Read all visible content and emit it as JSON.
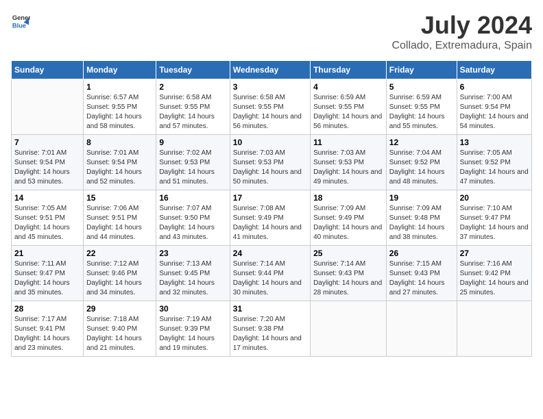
{
  "header": {
    "logo_general": "General",
    "logo_blue": "Blue",
    "month_year": "July 2024",
    "location": "Collado, Extremadura, Spain"
  },
  "weekdays": [
    "Sunday",
    "Monday",
    "Tuesday",
    "Wednesday",
    "Thursday",
    "Friday",
    "Saturday"
  ],
  "weeks": [
    [
      {
        "day": "",
        "sunrise": "",
        "sunset": "",
        "daylight": ""
      },
      {
        "day": "1",
        "sunrise": "Sunrise: 6:57 AM",
        "sunset": "Sunset: 9:55 PM",
        "daylight": "Daylight: 14 hours and 58 minutes."
      },
      {
        "day": "2",
        "sunrise": "Sunrise: 6:58 AM",
        "sunset": "Sunset: 9:55 PM",
        "daylight": "Daylight: 14 hours and 57 minutes."
      },
      {
        "day": "3",
        "sunrise": "Sunrise: 6:58 AM",
        "sunset": "Sunset: 9:55 PM",
        "daylight": "Daylight: 14 hours and 56 minutes."
      },
      {
        "day": "4",
        "sunrise": "Sunrise: 6:59 AM",
        "sunset": "Sunset: 9:55 PM",
        "daylight": "Daylight: 14 hours and 56 minutes."
      },
      {
        "day": "5",
        "sunrise": "Sunrise: 6:59 AM",
        "sunset": "Sunset: 9:55 PM",
        "daylight": "Daylight: 14 hours and 55 minutes."
      },
      {
        "day": "6",
        "sunrise": "Sunrise: 7:00 AM",
        "sunset": "Sunset: 9:54 PM",
        "daylight": "Daylight: 14 hours and 54 minutes."
      }
    ],
    [
      {
        "day": "7",
        "sunrise": "Sunrise: 7:01 AM",
        "sunset": "Sunset: 9:54 PM",
        "daylight": "Daylight: 14 hours and 53 minutes."
      },
      {
        "day": "8",
        "sunrise": "Sunrise: 7:01 AM",
        "sunset": "Sunset: 9:54 PM",
        "daylight": "Daylight: 14 hours and 52 minutes."
      },
      {
        "day": "9",
        "sunrise": "Sunrise: 7:02 AM",
        "sunset": "Sunset: 9:53 PM",
        "daylight": "Daylight: 14 hours and 51 minutes."
      },
      {
        "day": "10",
        "sunrise": "Sunrise: 7:03 AM",
        "sunset": "Sunset: 9:53 PM",
        "daylight": "Daylight: 14 hours and 50 minutes."
      },
      {
        "day": "11",
        "sunrise": "Sunrise: 7:03 AM",
        "sunset": "Sunset: 9:53 PM",
        "daylight": "Daylight: 14 hours and 49 minutes."
      },
      {
        "day": "12",
        "sunrise": "Sunrise: 7:04 AM",
        "sunset": "Sunset: 9:52 PM",
        "daylight": "Daylight: 14 hours and 48 minutes."
      },
      {
        "day": "13",
        "sunrise": "Sunrise: 7:05 AM",
        "sunset": "Sunset: 9:52 PM",
        "daylight": "Daylight: 14 hours and 47 minutes."
      }
    ],
    [
      {
        "day": "14",
        "sunrise": "Sunrise: 7:05 AM",
        "sunset": "Sunset: 9:51 PM",
        "daylight": "Daylight: 14 hours and 45 minutes."
      },
      {
        "day": "15",
        "sunrise": "Sunrise: 7:06 AM",
        "sunset": "Sunset: 9:51 PM",
        "daylight": "Daylight: 14 hours and 44 minutes."
      },
      {
        "day": "16",
        "sunrise": "Sunrise: 7:07 AM",
        "sunset": "Sunset: 9:50 PM",
        "daylight": "Daylight: 14 hours and 43 minutes."
      },
      {
        "day": "17",
        "sunrise": "Sunrise: 7:08 AM",
        "sunset": "Sunset: 9:49 PM",
        "daylight": "Daylight: 14 hours and 41 minutes."
      },
      {
        "day": "18",
        "sunrise": "Sunrise: 7:09 AM",
        "sunset": "Sunset: 9:49 PM",
        "daylight": "Daylight: 14 hours and 40 minutes."
      },
      {
        "day": "19",
        "sunrise": "Sunrise: 7:09 AM",
        "sunset": "Sunset: 9:48 PM",
        "daylight": "Daylight: 14 hours and 38 minutes."
      },
      {
        "day": "20",
        "sunrise": "Sunrise: 7:10 AM",
        "sunset": "Sunset: 9:47 PM",
        "daylight": "Daylight: 14 hours and 37 minutes."
      }
    ],
    [
      {
        "day": "21",
        "sunrise": "Sunrise: 7:11 AM",
        "sunset": "Sunset: 9:47 PM",
        "daylight": "Daylight: 14 hours and 35 minutes."
      },
      {
        "day": "22",
        "sunrise": "Sunrise: 7:12 AM",
        "sunset": "Sunset: 9:46 PM",
        "daylight": "Daylight: 14 hours and 34 minutes."
      },
      {
        "day": "23",
        "sunrise": "Sunrise: 7:13 AM",
        "sunset": "Sunset: 9:45 PM",
        "daylight": "Daylight: 14 hours and 32 minutes."
      },
      {
        "day": "24",
        "sunrise": "Sunrise: 7:14 AM",
        "sunset": "Sunset: 9:44 PM",
        "daylight": "Daylight: 14 hours and 30 minutes."
      },
      {
        "day": "25",
        "sunrise": "Sunrise: 7:14 AM",
        "sunset": "Sunset: 9:43 PM",
        "daylight": "Daylight: 14 hours and 28 minutes."
      },
      {
        "day": "26",
        "sunrise": "Sunrise: 7:15 AM",
        "sunset": "Sunset: 9:43 PM",
        "daylight": "Daylight: 14 hours and 27 minutes."
      },
      {
        "day": "27",
        "sunrise": "Sunrise: 7:16 AM",
        "sunset": "Sunset: 9:42 PM",
        "daylight": "Daylight: 14 hours and 25 minutes."
      }
    ],
    [
      {
        "day": "28",
        "sunrise": "Sunrise: 7:17 AM",
        "sunset": "Sunset: 9:41 PM",
        "daylight": "Daylight: 14 hours and 23 minutes."
      },
      {
        "day": "29",
        "sunrise": "Sunrise: 7:18 AM",
        "sunset": "Sunset: 9:40 PM",
        "daylight": "Daylight: 14 hours and 21 minutes."
      },
      {
        "day": "30",
        "sunrise": "Sunrise: 7:19 AM",
        "sunset": "Sunset: 9:39 PM",
        "daylight": "Daylight: 14 hours and 19 minutes."
      },
      {
        "day": "31",
        "sunrise": "Sunrise: 7:20 AM",
        "sunset": "Sunset: 9:38 PM",
        "daylight": "Daylight: 14 hours and 17 minutes."
      },
      {
        "day": "",
        "sunrise": "",
        "sunset": "",
        "daylight": ""
      },
      {
        "day": "",
        "sunrise": "",
        "sunset": "",
        "daylight": ""
      },
      {
        "day": "",
        "sunrise": "",
        "sunset": "",
        "daylight": ""
      }
    ]
  ]
}
